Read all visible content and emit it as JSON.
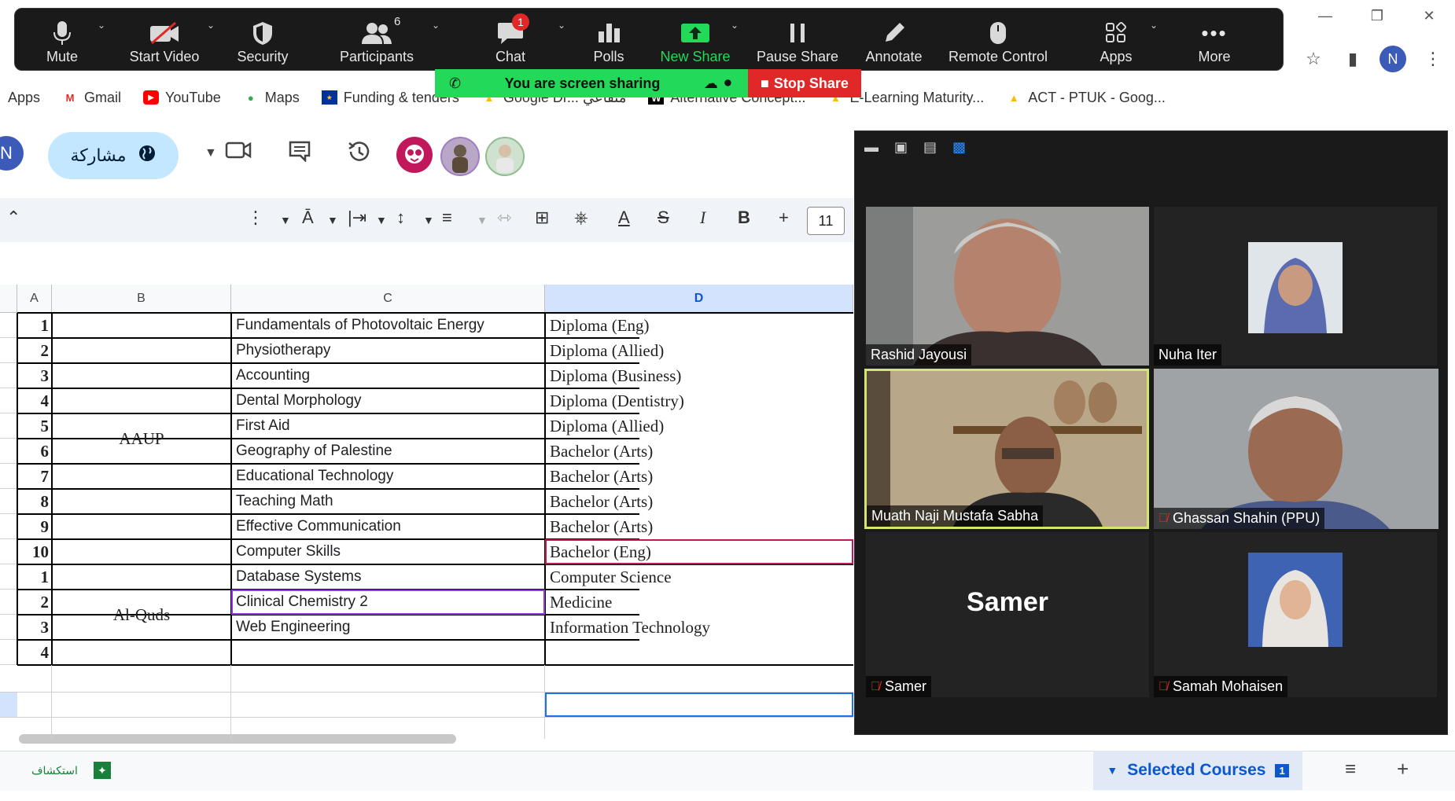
{
  "zoom_toolbar": {
    "buttons": [
      {
        "label": "Mute",
        "icon": "microphone-icon"
      },
      {
        "label": "Start Video",
        "icon": "video-off-icon"
      },
      {
        "label": "Security",
        "icon": "shield-icon"
      },
      {
        "label": "Participants",
        "icon": "participants-icon",
        "count": "6"
      },
      {
        "label": "Chat",
        "icon": "chat-icon",
        "badge": "1"
      },
      {
        "label": "Polls",
        "icon": "polls-icon"
      },
      {
        "label": "New Share",
        "icon": "share-up-icon"
      },
      {
        "label": "Pause Share",
        "icon": "pause-icon"
      },
      {
        "label": "Annotate",
        "icon": "pen-icon"
      },
      {
        "label": "Remote Control",
        "icon": "mouse-icon"
      },
      {
        "label": "Apps",
        "icon": "apps-icon"
      },
      {
        "label": "More",
        "icon": "more-icon"
      }
    ],
    "sharing_label": "You are screen sharing",
    "stop_share_label": "Stop Share",
    "new_share_color": "#23d959",
    "stop_color": "#e02828"
  },
  "bookmarks": [
    {
      "label": "Apps"
    },
    {
      "label": "Gmail"
    },
    {
      "label": "YouTube"
    },
    {
      "label": "Maps"
    },
    {
      "label": "Funding & tenders"
    },
    {
      "label": "Google Dr... متقاعي"
    },
    {
      "label": "Alternative Concept..."
    },
    {
      "label": "E-Learning Maturity..."
    },
    {
      "label": "ACT - PTUK  - Goog..."
    }
  ],
  "profile_initial": "N",
  "sheets": {
    "share_label": "مشاركة",
    "font_size": "11",
    "columns": [
      "A",
      "B",
      "C",
      "D"
    ],
    "groups": [
      {
        "university": "AAUP"
      },
      {
        "university": "Al-Quds"
      }
    ],
    "rows": [
      {
        "num": "1",
        "course": "Fundamentals of Photovoltaic Energy",
        "program": "Diploma (Eng)"
      },
      {
        "num": "2",
        "course": "Physiotherapy",
        "program": "Diploma (Allied)"
      },
      {
        "num": "3",
        "course": "Accounting",
        "program": "Diploma (Business)"
      },
      {
        "num": "4",
        "course": "Dental Morphology",
        "program": "Diploma (Dentistry)"
      },
      {
        "num": "5",
        "course": "First Aid",
        "program": "Diploma (Allied)"
      },
      {
        "num": "6",
        "course": "Geography of Palestine",
        "program": "Bachelor (Arts)"
      },
      {
        "num": "7",
        "course": "Educational Technology",
        "program": "Bachelor (Arts)"
      },
      {
        "num": "8",
        "course": "Teaching Math",
        "program": "Bachelor (Arts)"
      },
      {
        "num": "9",
        "course": "Effective Communication",
        "program": "Bachelor (Arts)"
      },
      {
        "num": "10",
        "course": "Computer Skills",
        "program": "Bachelor (Eng)"
      },
      {
        "num": "1",
        "course": "Database Systems",
        "program": "Computer Science"
      },
      {
        "num": "2",
        "course": "Clinical Chemistry 2",
        "program": "Medicine"
      },
      {
        "num": "3",
        "course": "Web Engineering",
        "program": "Information Technology"
      },
      {
        "num": "4",
        "course": "",
        "program": ""
      }
    ],
    "explore_label": "استكشاف",
    "sheet_tab": {
      "label": "Selected Courses",
      "count": "1"
    }
  },
  "video_panel": {
    "participants": [
      {
        "name": "Rashid Jayousi",
        "muted": false,
        "active": false
      },
      {
        "name": "Nuha Iter",
        "muted": false,
        "active": false
      },
      {
        "name": "Muath Naji Mustafa Sabha",
        "muted": false,
        "active": true
      },
      {
        "name": "Ghassan Shahin (PPU)",
        "muted": true,
        "active": false
      },
      {
        "name": "Samer",
        "muted": true,
        "active": false,
        "display_text": "Samer"
      },
      {
        "name": "Samah Mohaisen",
        "muted": true,
        "active": false
      }
    ]
  }
}
